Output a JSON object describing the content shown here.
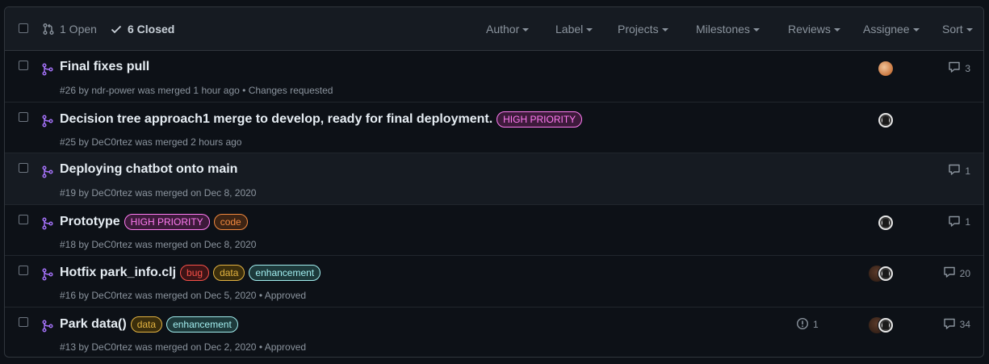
{
  "header": {
    "open_label": "1 Open",
    "closed_label": "6 Closed",
    "filters": [
      "Author",
      "Label",
      "Projects",
      "Milestones",
      "Reviews",
      "Assignee",
      "Sort"
    ]
  },
  "colors": {
    "merged_icon": "#a371f7",
    "high_priority": "#ff7bf2",
    "code": "#f0883e",
    "bug": "#f85149",
    "data": "#e3b341",
    "enhancement": "#a2eeef"
  },
  "prs": [
    {
      "title": "Final fixes pull",
      "labels": [],
      "number": "#26",
      "by": " by ",
      "author": "ndr-power",
      "status": " was merged 1 hour ago",
      "review": " • Changes requested",
      "avatars": [
        "orange"
      ],
      "comments": "3",
      "linked_issues": ""
    },
    {
      "title": "Decision tree approach1 merge to develop, ready for final deployment.",
      "labels": [
        {
          "text": "HIGH PRIORITY",
          "color": "#ff7bf2",
          "bg": "#3d1a3b"
        }
      ],
      "number": "#25",
      "by": " by ",
      "author": "DeC0rtez",
      "status": " was merged 2 hours ago",
      "review": "",
      "avatars": [
        "ghost"
      ],
      "comments": "",
      "linked_issues": ""
    },
    {
      "title": "Deploying chatbot onto main",
      "labels": [],
      "number": "#19",
      "by": " by ",
      "author": "DeC0rtez",
      "status": " was merged on Dec 8, 2020",
      "review": "",
      "avatars": [],
      "comments": "1",
      "linked_issues": ""
    },
    {
      "title": "Prototype",
      "labels": [
        {
          "text": "HIGH PRIORITY",
          "color": "#ff7bf2",
          "bg": "#3d1a3b"
        },
        {
          "text": "code",
          "color": "#f0883e",
          "bg": "#3d2414"
        }
      ],
      "number": "#18",
      "by": " by ",
      "author": "DeC0rtez",
      "status": " was merged on Dec 8, 2020",
      "review": "",
      "avatars": [
        "ghost"
      ],
      "comments": "1",
      "linked_issues": ""
    },
    {
      "title": "Hotfix park_info.clj",
      "labels": [
        {
          "text": "bug",
          "color": "#f85149",
          "bg": "#3d1416"
        },
        {
          "text": "data",
          "color": "#e3b341",
          "bg": "#3b2e0c"
        },
        {
          "text": "enhancement",
          "color": "#a2eeef",
          "bg": "#1d3a3b"
        }
      ],
      "number": "#16",
      "by": " by ",
      "author": "DeC0rtez",
      "status": " was merged on Dec 5, 2020",
      "review": " • Approved",
      "avatars": [
        "brown",
        "ghost"
      ],
      "comments": "20",
      "linked_issues": ""
    },
    {
      "title": "Park data()",
      "labels": [
        {
          "text": "data",
          "color": "#e3b341",
          "bg": "#3b2e0c"
        },
        {
          "text": "enhancement",
          "color": "#a2eeef",
          "bg": "#1d3a3b"
        }
      ],
      "number": "#13",
      "by": " by ",
      "author": "DeC0rtez",
      "status": " was merged on Dec 2, 2020",
      "review": " • Approved",
      "avatars": [
        "brown",
        "ghost"
      ],
      "comments": "34",
      "linked_issues": "1"
    }
  ]
}
